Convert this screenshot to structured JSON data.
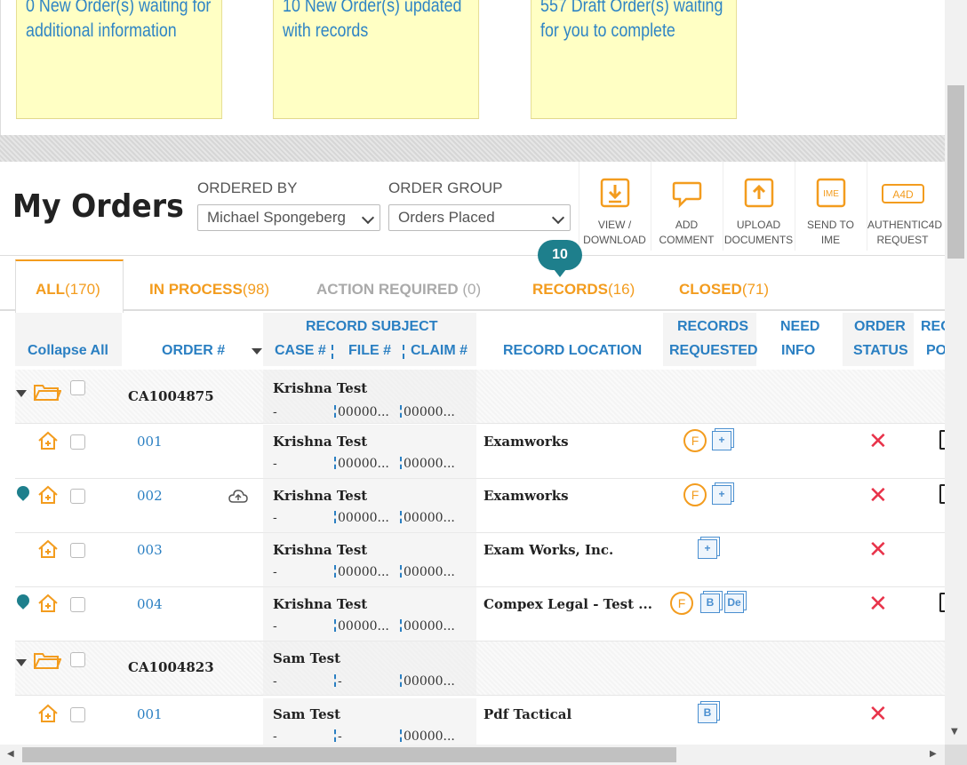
{
  "notes": [
    {
      "line1": "0 New Order(s) waiting for",
      "line2": "additional information"
    },
    {
      "line1": "10 New Order(s) updated",
      "line2": "with records"
    },
    {
      "line1": "557 Draft Order(s) waiting",
      "line2": "for you to complete"
    }
  ],
  "header": {
    "title": "My Orders",
    "ordered_by_label": "ORDERED BY",
    "ordered_by_value": "Michael Spongeberg",
    "order_group_label": "ORDER GROUP",
    "order_group_value": "Orders Placed"
  },
  "toolbar": [
    {
      "line1": "VIEW /",
      "line2": "DOWNLOAD",
      "icon": "download-icon"
    },
    {
      "line1": "ADD",
      "line2": "COMMENT",
      "icon": "comment-icon"
    },
    {
      "line1": "UPLOAD",
      "line2": "DOCUMENTS",
      "icon": "upload-icon"
    },
    {
      "line1": "SEND TO",
      "line2": "IME",
      "icon": "ime-icon",
      "badge": "IME"
    },
    {
      "line1": "AUTHENTIC4D",
      "line2": "REQUEST",
      "icon": "authentic4d-icon",
      "badge": "A4D"
    }
  ],
  "tabs": [
    {
      "label": "ALL",
      "count": "(170)"
    },
    {
      "label": "IN PROCESS",
      "count": "(98)"
    },
    {
      "label": "ACTION REQUIRED",
      "count": " (0)"
    },
    {
      "label": "RECORDS",
      "count": "(16)"
    },
    {
      "label": "CLOSED",
      "count": "(71)"
    }
  ],
  "records_badge": "10",
  "columns": {
    "collapse_all": "Collapse All",
    "order_num": "ORDER #",
    "record_subject": "RECORD SUBJECT",
    "case_num": "CASE #",
    "file_num": "FILE #",
    "claim_num": "CLAIM #",
    "record_location": "RECORD LOCATION",
    "records_requested_1": "RECORDS",
    "records_requested_2": "REQUESTED",
    "need_info_1": "NEED",
    "need_info_2": "INFO",
    "order_status_1": "ORDER",
    "order_status_2": "STATUS",
    "rec_po_1": "REC",
    "rec_po_2": "PO"
  },
  "rows": [
    {
      "type": "group",
      "order": "CA1004875",
      "subject": "Krishna Test",
      "case": "-",
      "file": "00000...",
      "claim": "00000..."
    },
    {
      "type": "item",
      "order": "001",
      "subject": "Krishna Test",
      "case": "-",
      "file": "00000...",
      "claim": "00000...",
      "location": "Examworks"
    },
    {
      "type": "item",
      "order": "002",
      "subject": "Krishna Test",
      "case": "-",
      "file": "00000...",
      "claim": "00000...",
      "location": "Examworks"
    },
    {
      "type": "item",
      "order": "003",
      "subject": "Krishna Test",
      "case": "-",
      "file": "00000...",
      "claim": "00000...",
      "location": "Exam Works, Inc."
    },
    {
      "type": "item",
      "order": "004",
      "subject": "Krishna Test",
      "case": "-",
      "file": "00000...",
      "claim": "00000...",
      "location": "Compex Legal - Test ..."
    },
    {
      "type": "group",
      "order": "CA1004823",
      "subject": "Sam Test",
      "case": "-",
      "file": "-",
      "claim": "00000..."
    },
    {
      "type": "item",
      "order": "001",
      "subject": "Sam Test",
      "case": "-",
      "file": "-",
      "claim": "00000...",
      "location": "Pdf Tactical"
    }
  ],
  "record_badges": {
    "f": "F",
    "b": "B",
    "de": "De",
    "plus": "+"
  },
  "status_icon": "close-x-icon",
  "colors": {
    "accent_orange": "#f39c1e",
    "link_blue": "#2a7fc2",
    "teal": "#1e7f8c",
    "red": "#e8334a",
    "note_yellow": "#ffffc4"
  }
}
